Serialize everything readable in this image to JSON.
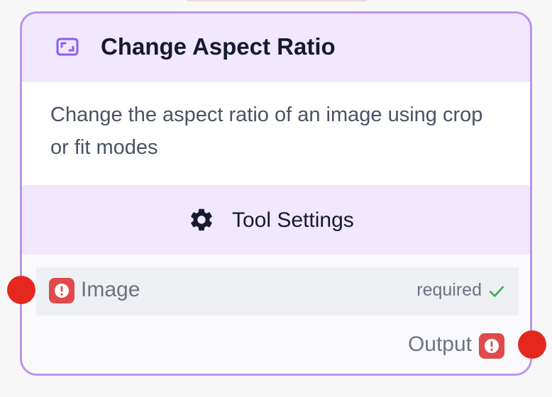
{
  "node": {
    "title": "Change Aspect Ratio",
    "title_icon": "aspect-ratio-icon",
    "description": "Change the aspect ratio of an image using crop or fit modes"
  },
  "settings": {
    "label": "Tool Settings",
    "icon": "gear-icon"
  },
  "ports": {
    "input": {
      "label": "Image",
      "status": "required",
      "status_icon": "check-icon",
      "warning_icon": "alert-icon"
    },
    "output": {
      "label": "Output",
      "warning_icon": "alert-icon"
    }
  },
  "colors": {
    "accent_border": "#bb93f0",
    "header_bg": "#f1e7fe",
    "warning": "#e04a4a",
    "port_dot": "#e5281e",
    "check": "#3aa85a"
  }
}
